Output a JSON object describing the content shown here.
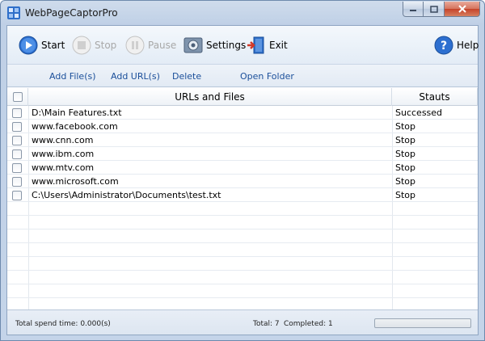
{
  "window": {
    "title": "WebPageCaptorPro"
  },
  "toolbar": {
    "start": "Start",
    "stop": "Stop",
    "pause": "Pause",
    "settings": "Settings",
    "exit": "Exit",
    "help": "Help"
  },
  "actions": {
    "add_files": "Add File(s)",
    "add_urls": "Add URL(s)",
    "delete": "Delete",
    "open_folder": "Open Folder"
  },
  "table": {
    "columns": [
      "URLs and Files",
      "Stauts"
    ],
    "rows": [
      {
        "item": "D:\\Main Features.txt",
        "status": "Successed"
      },
      {
        "item": "www.facebook.com",
        "status": "Stop"
      },
      {
        "item": "www.cnn.com",
        "status": "Stop"
      },
      {
        "item": "www.ibm.com",
        "status": "Stop"
      },
      {
        "item": "www.mtv.com",
        "status": "Stop"
      },
      {
        "item": "www.microsoft.com",
        "status": "Stop"
      },
      {
        "item": "C:\\Users\\Administrator\\Documents\\test.txt",
        "status": "Stop"
      }
    ]
  },
  "status": {
    "spend_time": "Total spend time: 0.000(s)",
    "total": "Total: 7",
    "completed": "Completed: 1",
    "progress_fraction": 0
  },
  "colors": {
    "link": "#1b4f9a",
    "window_frame": "#bfd0e6",
    "close_button": "#c5432a"
  }
}
